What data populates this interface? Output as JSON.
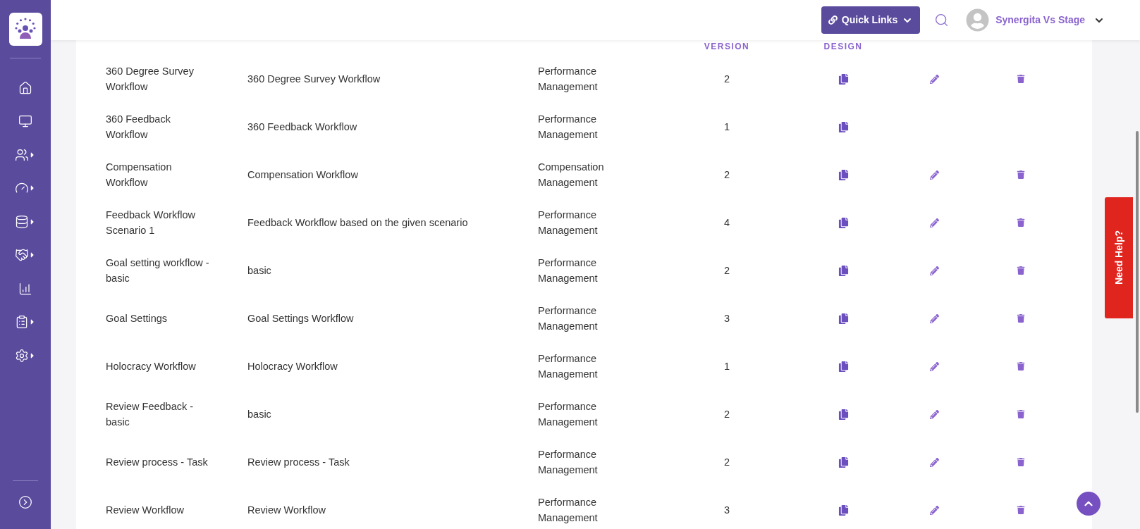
{
  "sidebar": {
    "items": [
      {
        "has_submenu": false
      },
      {
        "has_submenu": false
      },
      {
        "has_submenu": true
      },
      {
        "has_submenu": true
      },
      {
        "has_submenu": true
      },
      {
        "has_submenu": true
      },
      {
        "has_submenu": false
      },
      {
        "has_submenu": true
      },
      {
        "has_submenu": true
      }
    ]
  },
  "top_bar": {
    "quick_links": "Quick Links",
    "user_name": "Synergita Vs Stage"
  },
  "table": {
    "header": [
      "VERSION",
      "DESIGN"
    ],
    "rows": [
      {
        "name": "360 Degree Survey Workflow",
        "description": "360 Degree Survey Workflow",
        "module": "Performance Management",
        "version": "2",
        "editable": true,
        "deletable": true
      },
      {
        "name": "360 Feedback Workflow",
        "description": "360 Feedback Workflow",
        "module": "Performance Management",
        "version": "1",
        "editable": false,
        "deletable": false
      },
      {
        "name": "Compensation Workflow",
        "description": "Compensation Workflow",
        "module": "Compensation Management",
        "version": "2",
        "editable": true,
        "deletable": true
      },
      {
        "name": "Feedback Workflow Scenario 1",
        "description": "Feedback Workflow based on the given scenario",
        "module": "Performance Management",
        "version": "4",
        "editable": true,
        "deletable": true
      },
      {
        "name": "Goal setting workflow - basic",
        "description": "basic",
        "module": "Performance Management",
        "version": "2",
        "editable": true,
        "deletable": true
      },
      {
        "name": "Goal Settings",
        "description": "Goal Settings Workflow",
        "module": "Performance Management",
        "version": "3",
        "editable": true,
        "deletable": true
      },
      {
        "name": "Holocracy Workflow",
        "description": "Holocracy Workflow",
        "module": "Performance Management",
        "version": "1",
        "editable": true,
        "deletable": true
      },
      {
        "name": "Review Feedback - basic",
        "description": "basic",
        "module": "Performance Management",
        "version": "2",
        "editable": true,
        "deletable": true
      },
      {
        "name": "Review process - Task",
        "description": "Review process - Task",
        "module": "Performance Management",
        "version": "2",
        "editable": true,
        "deletable": true
      },
      {
        "name": "Review Workflow",
        "description": "Review Workflow",
        "module": "Performance Management",
        "version": "3",
        "editable": true,
        "deletable": true
      }
    ]
  },
  "help_tab": {
    "label": "Need Help?"
  }
}
